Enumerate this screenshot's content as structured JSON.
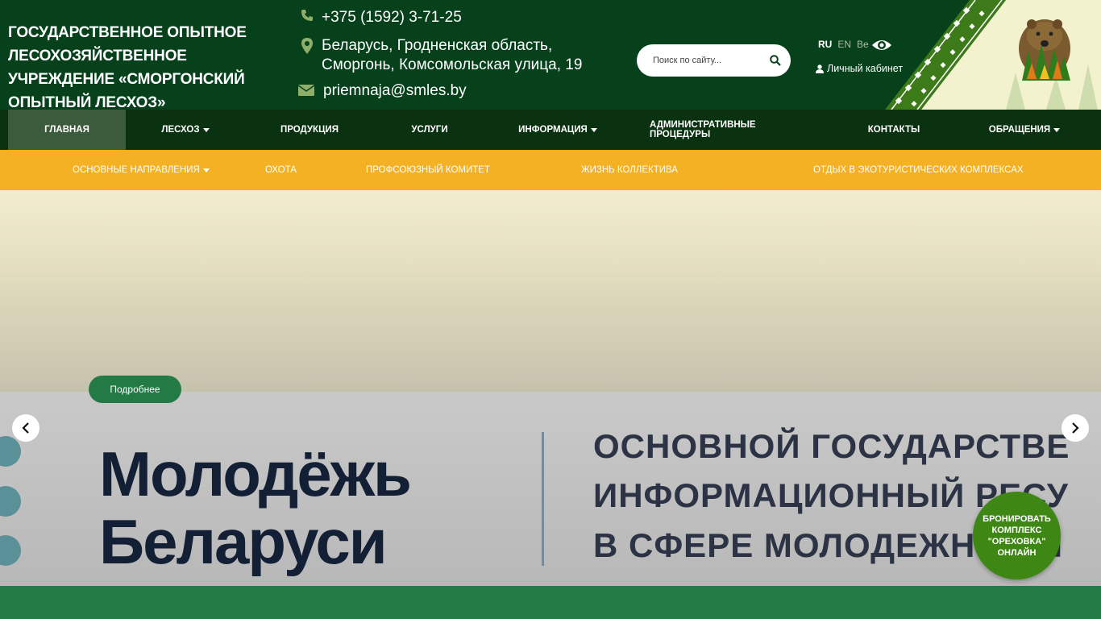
{
  "header": {
    "org_title": "Государственное опытное лесохозяйственное учреждение «Сморгонский опытный лесхоз»",
    "phone": "+375 (1592) 3-71-25",
    "address": "Беларусь, Гродненская область, Сморгонь, Комсомольская улица, 19",
    "email": "priemnaja@smles.by",
    "search_placeholder": "Поиск по сайту...",
    "languages": [
      "RU",
      "EN",
      "Be"
    ],
    "active_language": "RU",
    "cabinet_label": "Личный кабинет"
  },
  "main_nav": [
    {
      "label": "Главная",
      "active": true
    },
    {
      "label": "Лесхоз",
      "dropdown": true
    },
    {
      "label": "Продукция"
    },
    {
      "label": "Услуги"
    },
    {
      "label": "Информация",
      "dropdown": true
    },
    {
      "label": "Административные процедуры"
    },
    {
      "label": "Контакты"
    },
    {
      "label": "Обращения",
      "dropdown": true
    }
  ],
  "sub_nav": [
    {
      "label": "Основные направления",
      "dropdown": true
    },
    {
      "label": "Охота"
    },
    {
      "label": "Профсоюзный комитет"
    },
    {
      "label": "Жизнь коллектива"
    },
    {
      "label": "Отдых в экотуристических комплексах"
    }
  ],
  "slider": {
    "more_button": "Подробнее",
    "banner_left_line1": "Молодёжь",
    "banner_left_line2": "Беларуси",
    "banner_right_line1": "ОСНОВНОЙ ГОСУДАРСТВЕ",
    "banner_right_line2": "ИНФОРМАЦИОННЫЙ РЕСУ",
    "banner_right_line3": "В СФЕРЕ МОЛОДЕЖНОЙ П"
  },
  "booking_button": "Бронировать комплекс \"Ореховка\" онлайн",
  "colors": {
    "header_bg": "#06411c",
    "main_nav_bg": "#0a3211",
    "sub_nav_bg": "#f3b123",
    "accent_green": "#237a45",
    "booking_green": "#3f8714"
  }
}
